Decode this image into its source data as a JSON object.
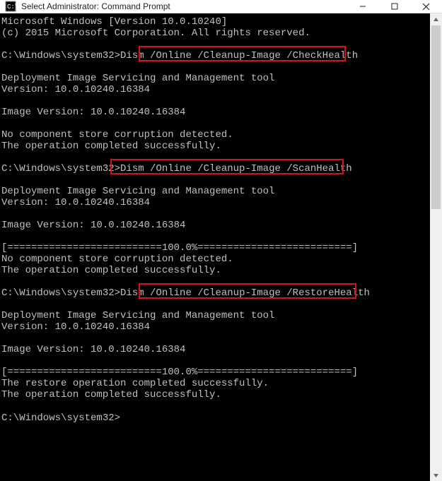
{
  "window": {
    "title": "Select Administrator: Command Prompt"
  },
  "terminal": {
    "line1": "Microsoft Windows [Version 10.0.10240]",
    "line2": "(c) 2015 Microsoft Corporation. All rights reserved.",
    "blank": "",
    "prompt": "C:\\Windows\\system32>",
    "cmd1_pre": "Dism ",
    "cmd1_hl": "/Online /Cleanup-Image /CheckHealth",
    "dism_tool": "Deployment Image Servicing and Management tool",
    "dism_ver": "Version: 10.0.10240.16384",
    "img_ver": "Image Version: 10.0.10240.16384",
    "no_corrupt": "No component store corruption detected.",
    "op_success": "The operation completed successfully.",
    "cmd2_hl": "Dism /Online /Cleanup-Image /ScanHealth",
    "progress": "[==========================100.0%==========================]",
    "cmd3_pre": "Dism ",
    "cmd3_hl": "/Online /Cleanup-Image /RestoreHealth",
    "restore_success": "The restore operation completed successfully.",
    "final_prompt": "C:\\Windows\\system32>"
  }
}
